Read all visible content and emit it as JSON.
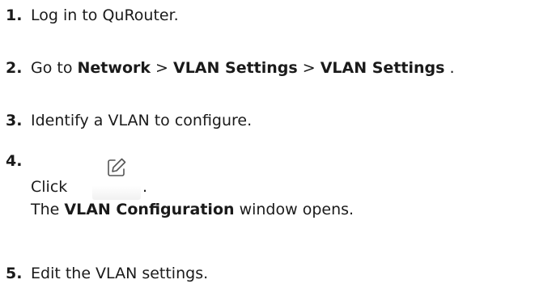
{
  "steps": [
    {
      "number": "1.",
      "text": "Log in to QuRouter."
    },
    {
      "number": "2.",
      "prefix": "Go to ",
      "menu1": "Network",
      "sep1": " > ",
      "menu2": "VLAN Settings",
      "sep2": " > ",
      "menu3": "VLAN Settings",
      "suffix": " ."
    },
    {
      "number": "3.",
      "text": "Identify a VLAN to configure."
    },
    {
      "number": "4.",
      "click_text": "Click",
      "icon": "edit-icon",
      "period": ".",
      "result_prefix": "The ",
      "result_bold": "VLAN Configuration",
      "result_suffix": " window opens."
    },
    {
      "number": "5.",
      "text": "Edit the VLAN settings."
    }
  ]
}
